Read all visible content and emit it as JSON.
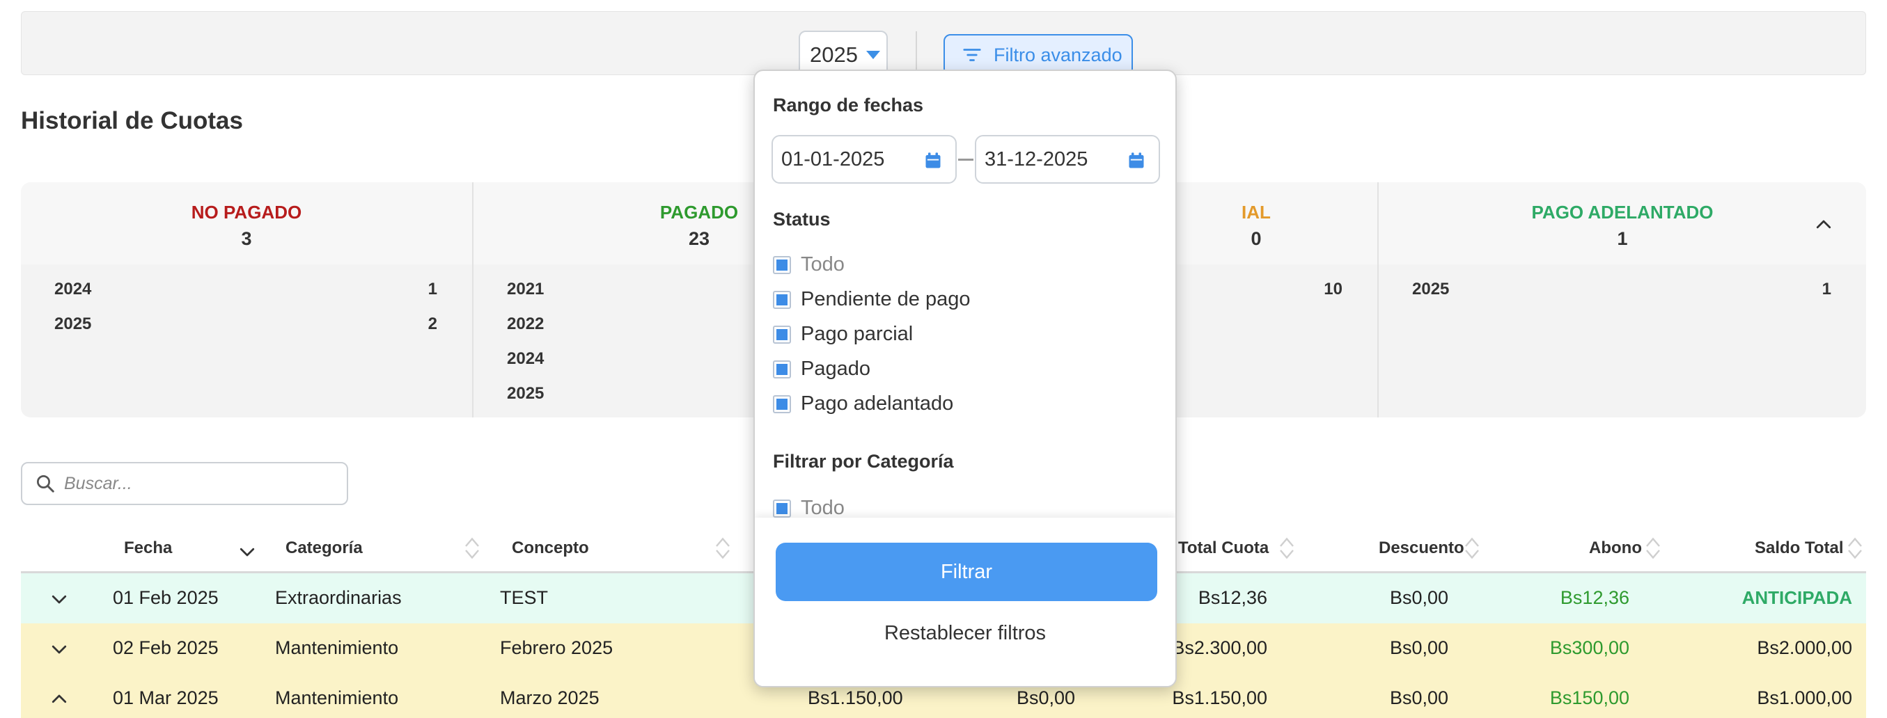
{
  "toolbar": {
    "year": "2025",
    "advanced_filter_label": "Filtro avanzado"
  },
  "page_title": "Historial de Cuotas",
  "summary": [
    {
      "label": "NO PAGADO",
      "color": "#b71c1c",
      "count": "3",
      "rows": [
        {
          "year": "2024",
          "count": "1"
        },
        {
          "year": "2025",
          "count": "2"
        }
      ]
    },
    {
      "label": "PAGADO",
      "color": "#2e9a2e",
      "count": "23",
      "rows": [
        {
          "year": "2021",
          "count": ""
        },
        {
          "year": "2022",
          "count": ""
        },
        {
          "year": "2024",
          "count": ""
        },
        {
          "year": "2025",
          "count": ""
        }
      ]
    },
    {
      "label": "IAL",
      "color": "#e39a2b",
      "count": "0",
      "rows": [
        {
          "year": "",
          "count": "10"
        }
      ]
    },
    {
      "label": "PAGO ADELANTADO",
      "color": "#2eaa66",
      "count": "1",
      "rows": [
        {
          "year": "2025",
          "count": "1"
        }
      ]
    }
  ],
  "search": {
    "placeholder": "Buscar..."
  },
  "table": {
    "headers": {
      "fecha": "Fecha",
      "categoria": "Categoría",
      "concepto": "Concepto",
      "total_cuota": "Total Cuota",
      "descuento": "Descuento",
      "abono": "Abono",
      "saldo_total": "Saldo Total"
    },
    "rows": [
      {
        "fecha": "01 Feb 2025",
        "categoria": "Extraordinarias",
        "concepto": "TEST",
        "monto": "",
        "pagado": "",
        "total_cuota": "Bs12,36",
        "descuento": "Bs0,00",
        "abono": "Bs12,36",
        "saldo_total": "ANTICIPADA",
        "bg": "#e6fbf3",
        "saldo_color": "#2eaa66",
        "expanded": false
      },
      {
        "fecha": "02 Feb 2025",
        "categoria": "Mantenimiento",
        "concepto": "Febrero 2025",
        "monto": "",
        "pagado": "",
        "total_cuota": "Bs2.300,00",
        "descuento": "Bs0,00",
        "abono": "Bs300,00",
        "saldo_total": "Bs2.000,00",
        "bg": "#fbf3c8",
        "saldo_color": "#222",
        "expanded": false
      },
      {
        "fecha": "01 Mar 2025",
        "categoria": "Mantenimiento",
        "concepto": "Marzo 2025",
        "monto": "Bs1.150,00",
        "pagado": "Bs0,00",
        "total_cuota": "Bs1.150,00",
        "descuento": "Bs0,00",
        "abono": "Bs150,00",
        "saldo_total": "Bs1.000,00",
        "bg": "#fbf3c8",
        "saldo_color": "#222",
        "expanded": true
      }
    ]
  },
  "filter_panel": {
    "date_range_title": "Rango de fechas",
    "date_from": "01-01-2025",
    "date_to": "31-12-2025",
    "status_title": "Status",
    "status_options": [
      "Todo",
      "Pendiente de pago",
      "Pago parcial",
      "Pagado",
      "Pago adelantado"
    ],
    "category_title": "Filtrar por Categoría",
    "category_options": [
      "Todo"
    ],
    "filter_button": "Filtrar",
    "reset_button": "Restablecer filtros"
  },
  "colors": {
    "accent": "#4a9af2",
    "abono_green": "#2e9a2e"
  }
}
